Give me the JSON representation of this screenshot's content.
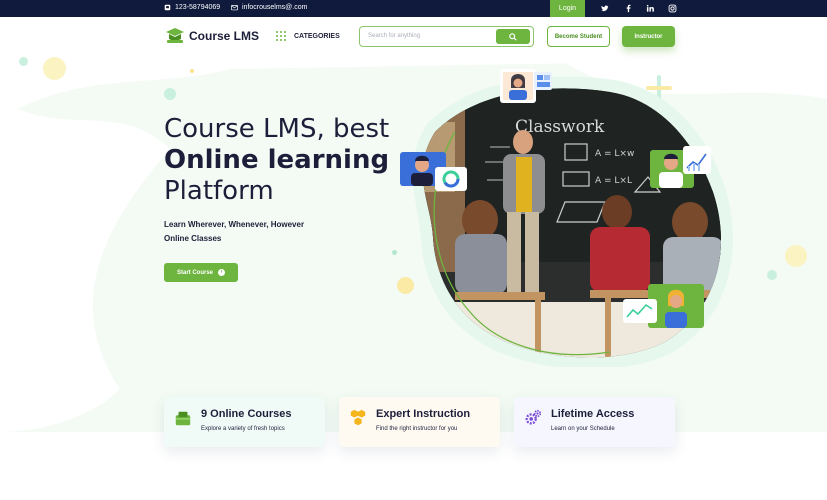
{
  "topbar": {
    "phone": "123-58794069",
    "email": "infocrouselms@.com",
    "login": "Login",
    "social_icons": [
      "twitter-icon",
      "facebook-icon",
      "linkedin-icon",
      "instagram-icon"
    ]
  },
  "header": {
    "logo_text": "Course LMS",
    "categories": "CATEGORIES",
    "search_placeholder": "Search for anything",
    "become_student": "Become Student",
    "instructor": "Instructor"
  },
  "hero": {
    "title_line1": "Course LMS, best",
    "title_line2": "Online learning",
    "title_line3": "Platform",
    "subtitle_line1": "Learn Wherever, Whenever, However",
    "subtitle_line2": "Online Classes",
    "cta": "Start Course",
    "board_text": "Classwork"
  },
  "features": [
    {
      "title": "9 Online Courses",
      "subtitle": "Explore a variety of fresh topics",
      "icon": "course-box-icon"
    },
    {
      "title": "Expert Instruction",
      "subtitle": "Find the right instructor for you",
      "icon": "hexagon-cluster-icon"
    },
    {
      "title": "Lifetime Access",
      "subtitle": "Learn on your Schedule",
      "icon": "gears-icon"
    }
  ],
  "colors": {
    "brand_green": "#6eb540",
    "navy": "#0f1a3c",
    "text_dark": "#1d1f3a"
  }
}
